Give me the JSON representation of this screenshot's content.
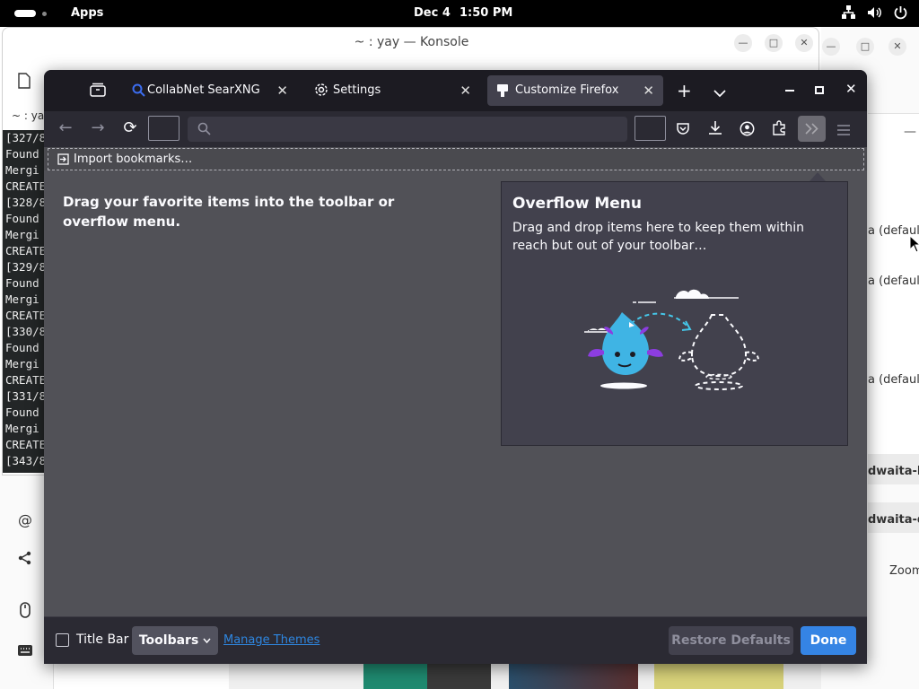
{
  "topbar": {
    "apps": "Apps",
    "date": "Dec 4",
    "time": "1:50 PM"
  },
  "konsole": {
    "title": "~ : yay — Konsole",
    "tab_label": "~ : yay",
    "lines": [
      "[327/8",
      "Found",
      "Mergi",
      "CREATE",
      "[328/8",
      "Found",
      "Mergi",
      "CREATE",
      "[329/8",
      "Found",
      "Mergi",
      "CREATE",
      "[330/8",
      "Found",
      "Mergi",
      "CREATE",
      "[331/8",
      "Found",
      "Mergi",
      "CREATE",
      "[343/8"
    ]
  },
  "settings_bg": {
    "row1": "a (default",
    "row2": "a (default",
    "row3": "a (default",
    "row4": "dwaita-l.j",
    "row5": "dwaita-d.",
    "row6": "Zoom"
  },
  "firefox": {
    "tabs": [
      {
        "label": "CollabNet SearXNG"
      },
      {
        "label": "Settings"
      },
      {
        "label": "Customize Firefox"
      }
    ],
    "bookmarks": {
      "import_label": "Import bookmarks…"
    },
    "instructions": "Drag your favorite items into the toolbar or overflow menu.",
    "overflow_menu": {
      "title": "Overflow Menu",
      "description": "Drag and drop items here to keep them within reach but out of your toolbar…"
    },
    "footer": {
      "title_bar_label": "Title Bar",
      "toolbars_label": "Toolbars",
      "manage_themes_label": "Manage Themes",
      "restore_defaults_label": "Restore Defaults",
      "done_label": "Done"
    }
  },
  "colors": {
    "accent": "#0060df",
    "done_button": "#3584e4",
    "toolbar": "#2b2a33",
    "tabstrip": "#1c1b22"
  }
}
